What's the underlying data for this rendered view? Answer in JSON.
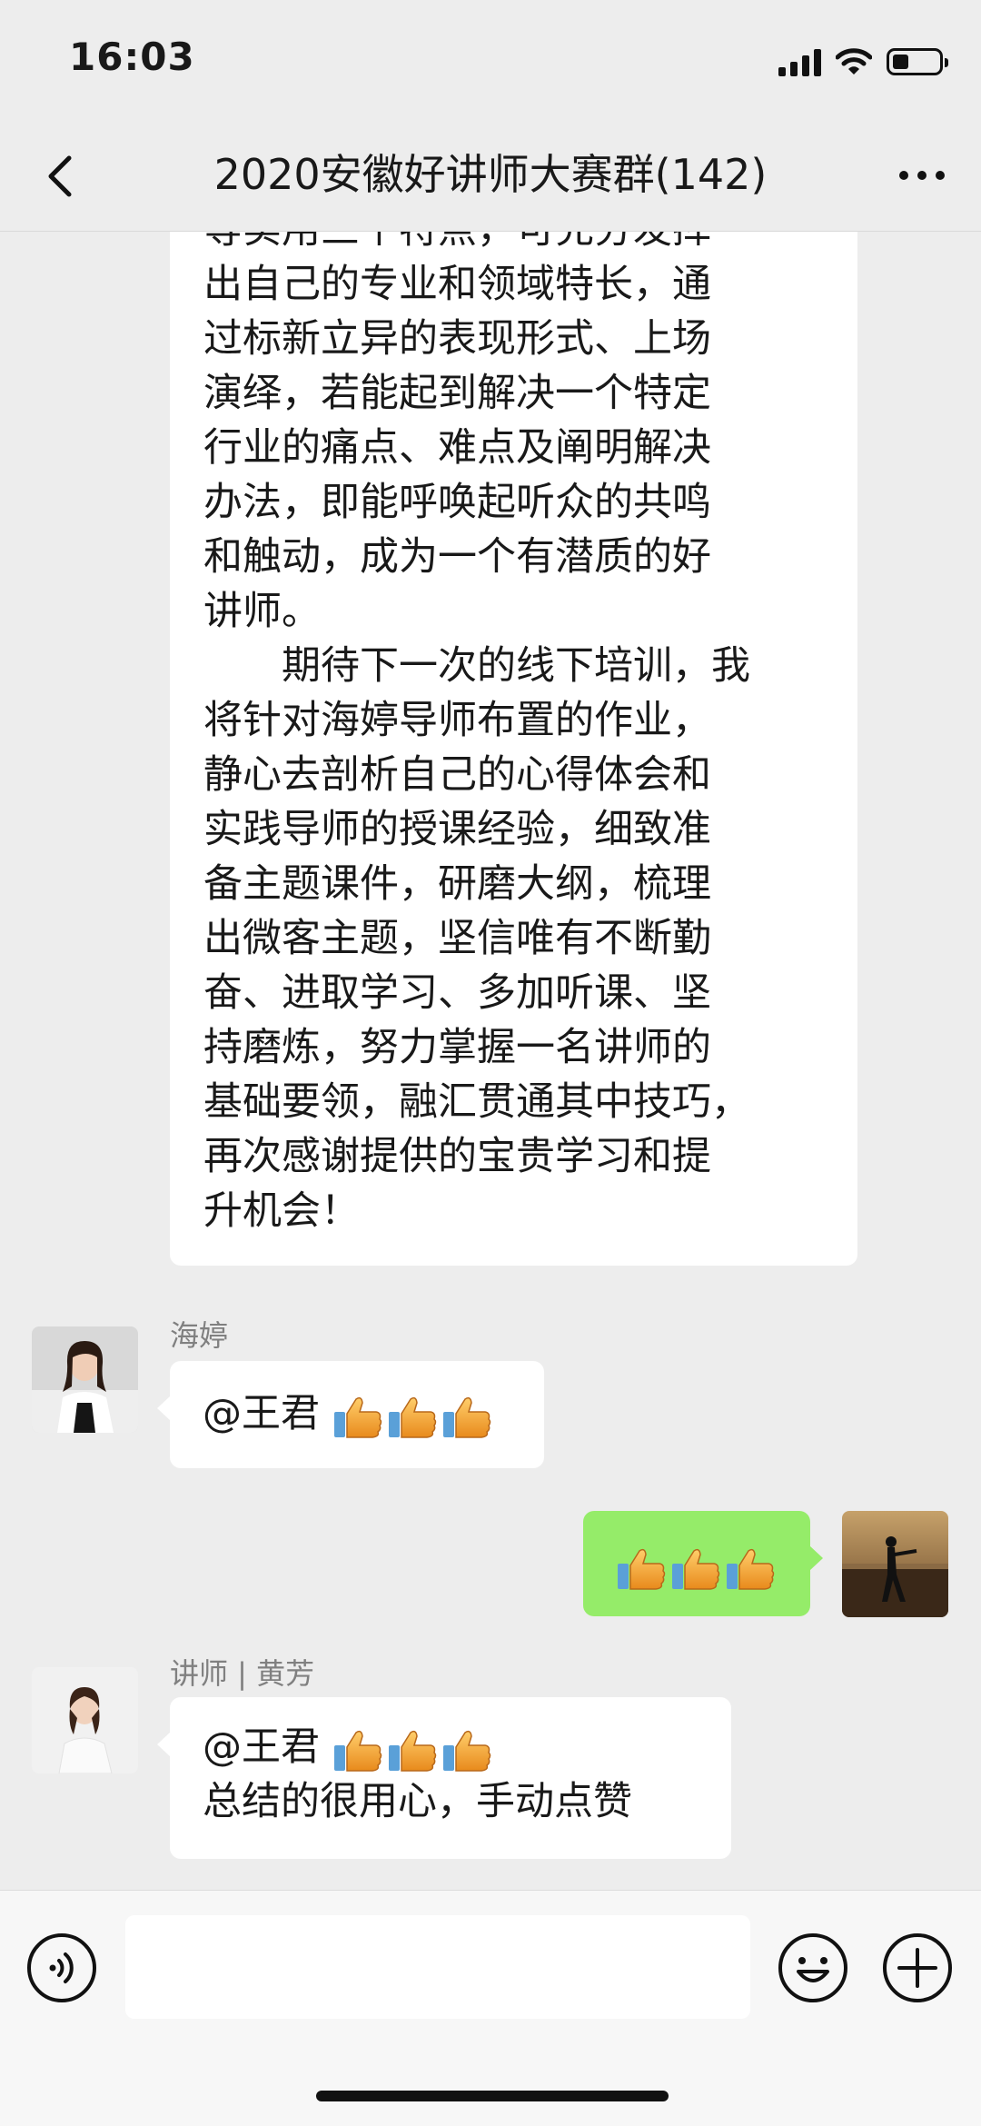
{
  "status": {
    "time": "16:03",
    "battery_level": 0.35
  },
  "nav": {
    "title": "2020安徽好讲师大赛群(142)"
  },
  "messages": {
    "long": {
      "lines_p1": [
        "等实用三个特点，可充分发挥",
        "出自己的专业和领域特长，通",
        "过标新立异的表现形式、上场",
        "演绎，若能起到解决一个特定",
        "行业的痛点、难点及阐明解决",
        "办法，即能呼唤起听众的共鸣",
        "和触动，成为一个有潜质的好",
        "讲师。"
      ],
      "lines_p2": [
        "期待下一次的线下培训，我",
        "将针对海婷导师布置的作业，",
        "静心去剖析自己的心得体会和",
        "实践导师的授课经验，细致准",
        "备主题课件，研磨大纲，梳理",
        "出微客主题，坚信唯有不断勤",
        "奋、进取学习、多加听课、坚",
        "持磨炼，努力掌握一名讲师的",
        "基础要领，融汇贯通其中技巧，",
        "再次感谢提供的宝贵学习和提",
        "升机会！"
      ]
    },
    "m1": {
      "sender": "海婷",
      "text": "@王君 "
    },
    "m3": {
      "sender": "讲师 | 黄芳",
      "line1": "@王君 ",
      "line2": "总结的很用心，手动点赞"
    }
  },
  "colors": {
    "background": "#ededed",
    "bubble_self": "#95ec69",
    "bubble_other": "#ffffff",
    "thumb": "#f2a93b"
  }
}
